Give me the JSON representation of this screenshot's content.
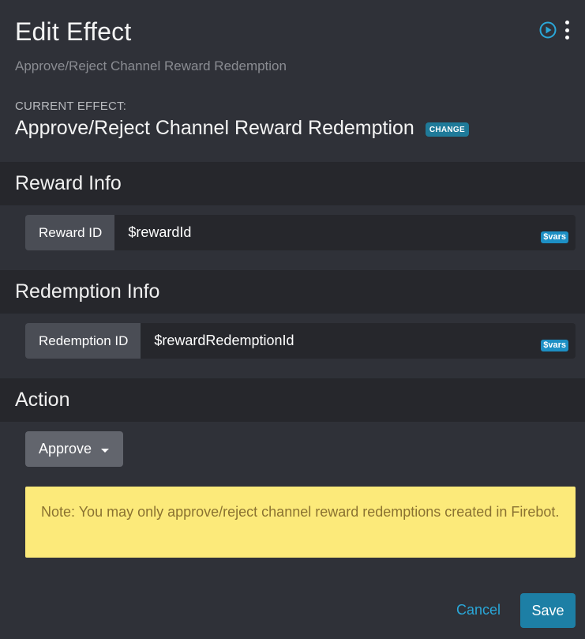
{
  "header": {
    "title": "Edit Effect",
    "subtitle": "Approve/Reject Channel Reward Redemption"
  },
  "current_effect": {
    "label": "CURRENT EFFECT:",
    "name": "Approve/Reject Channel Reward Redemption",
    "change_label": "CHANGE"
  },
  "sections": {
    "reward_info": {
      "title": "Reward Info",
      "field_label": "Reward ID",
      "field_value": "$rewardId",
      "vars_label": "$vars"
    },
    "redemption_info": {
      "title": "Redemption Info",
      "field_label": "Redemption ID",
      "field_value": "$rewardRedemptionId",
      "vars_label": "$vars"
    },
    "action": {
      "title": "Action",
      "selected": "Approve"
    }
  },
  "note": "Note: You may only approve/reject channel reward redemptions created in Firebot.",
  "footer": {
    "cancel_label": "Cancel",
    "save_label": "Save"
  },
  "colors": {
    "background": "#2f3138",
    "section_header": "#26272c",
    "accent": "#1d7fa5",
    "link": "#2aa7d8",
    "note_background": "#fcea7a",
    "note_text": "#8a7231"
  },
  "icons": {
    "play": "play-circle-icon",
    "menu": "kebab-menu-icon",
    "caret": "caret-down-icon"
  }
}
